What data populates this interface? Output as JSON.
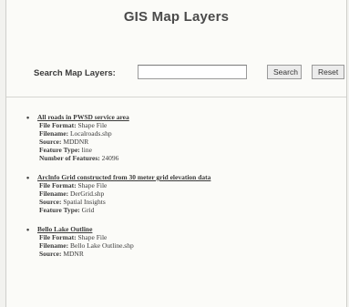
{
  "page": {
    "title": "GIS Map Layers"
  },
  "search": {
    "label": "Search Map Layers:",
    "value": "",
    "placeholder": "",
    "search_button": "Search",
    "reset_button": "Reset"
  },
  "layers": [
    {
      "link": "All roads in PWSD service area",
      "props": [
        {
          "key": "File Format:",
          "value": "Shape File"
        },
        {
          "key": "Filename:",
          "value": "Localroads.shp"
        },
        {
          "key": "Source:",
          "value": "MDDNR"
        },
        {
          "key": "Feature Type:",
          "value": "line"
        },
        {
          "key": "Number of Features:",
          "value": "24096"
        }
      ]
    },
    {
      "link": "Arclnfo Grid constructed from 30 meter grid elevation data",
      "props": [
        {
          "key": "File Format:",
          "value": "Shape File"
        },
        {
          "key": "Filename:",
          "value": "DerGrid.shp"
        },
        {
          "key": "Source:",
          "value": "Spatial Insights"
        },
        {
          "key": "Feature Type:",
          "value": "Grid"
        }
      ]
    },
    {
      "link": "Bello Lake Outline",
      "props": [
        {
          "key": "File Format:",
          "value": "Shape File"
        },
        {
          "key": "Filename:",
          "value": "Bello Lake Outline.shp"
        },
        {
          "key": "Source:",
          "value": "MDNR"
        }
      ]
    }
  ]
}
